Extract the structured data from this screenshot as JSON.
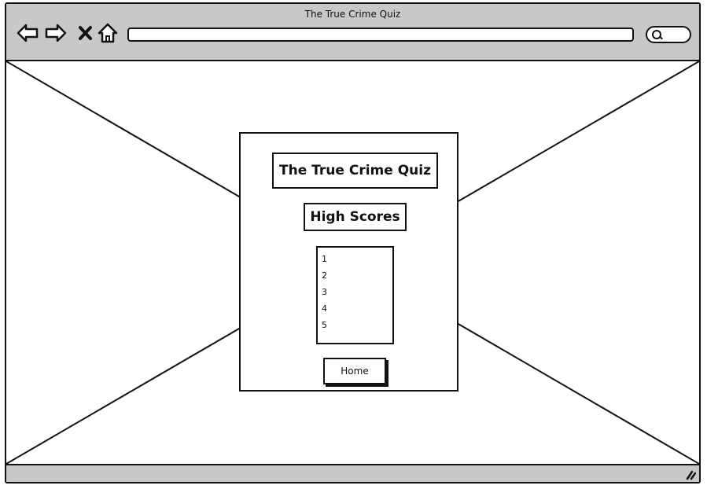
{
  "window": {
    "title": "The True Crime Quiz"
  },
  "toolbar": {
    "icons": [
      "back-arrow-icon",
      "forward-arrow-icon",
      "stop-icon",
      "home-icon"
    ],
    "address_value": "",
    "search_icon": "search-icon"
  },
  "page": {
    "title": "The True Crime Quiz",
    "heading": "High Scores",
    "high_scores": [
      "1",
      "2",
      "3",
      "4",
      "5"
    ],
    "home_button_label": "Home"
  },
  "colors": {
    "chrome": "#c8c8c8",
    "stroke": "#111111",
    "background": "#ffffff"
  }
}
